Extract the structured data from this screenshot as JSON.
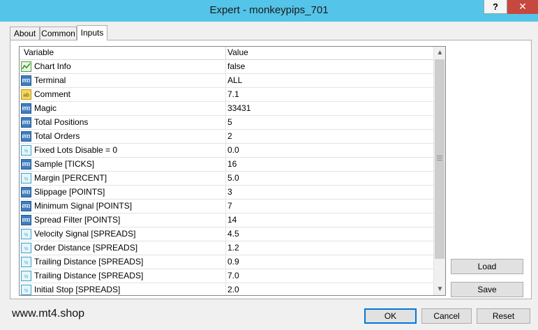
{
  "window": {
    "title": "Expert - monkeypips_701",
    "help_label": "?",
    "close_label": "✕"
  },
  "tabs": [
    {
      "label": "About"
    },
    {
      "label": "Common"
    },
    {
      "label": "Inputs",
      "active": true
    }
  ],
  "grid": {
    "columns": {
      "variable": "Variable",
      "value": "Value"
    },
    "rows": [
      {
        "icon": "chart-icon",
        "name": "Chart Info",
        "value": "false"
      },
      {
        "icon": "integer-icon",
        "name": "Terminal",
        "value": "ALL"
      },
      {
        "icon": "string-icon",
        "name": "Comment",
        "value": "7.1"
      },
      {
        "icon": "integer-icon",
        "name": "Magic",
        "value": "33431"
      },
      {
        "icon": "integer-icon",
        "name": "Total Positions",
        "value": "5"
      },
      {
        "icon": "integer-icon",
        "name": "Total Orders",
        "value": "2"
      },
      {
        "icon": "double-icon",
        "name": "Fixed Lots Disable = 0",
        "value": "0.0"
      },
      {
        "icon": "integer-icon",
        "name": "Sample [TICKS]",
        "value": "16"
      },
      {
        "icon": "double-icon",
        "name": "Margin [PERCENT]",
        "value": "5.0"
      },
      {
        "icon": "integer-icon",
        "name": "Slippage [POINTS]",
        "value": "3"
      },
      {
        "icon": "integer-icon",
        "name": "Minimum Signal [POINTS]",
        "value": "7"
      },
      {
        "icon": "integer-icon",
        "name": "Spread Filter [POINTS]",
        "value": "14"
      },
      {
        "icon": "double-icon",
        "name": "Velocity Signal [SPREADS]",
        "value": "4.5"
      },
      {
        "icon": "double-icon",
        "name": "Order Distance [SPREADS]",
        "value": "1.2"
      },
      {
        "icon": "double-icon",
        "name": "Trailing Distance [SPREADS]",
        "value": "0.9"
      },
      {
        "icon": "double-icon",
        "name": "Trailing Distance [SPREADS]",
        "value": "7.0"
      },
      {
        "icon": "double-icon",
        "name": "Initial Stop [SPREADS]",
        "value": "2.0"
      }
    ]
  },
  "buttons": {
    "load": "Load",
    "save": "Save",
    "ok": "OK",
    "cancel": "Cancel",
    "reset": "Reset"
  },
  "footer": {
    "website": "www.mt4.shop"
  },
  "colors": {
    "titlebar": "#54c4e8",
    "close": "#c7483e",
    "focus": "#0078d7"
  }
}
